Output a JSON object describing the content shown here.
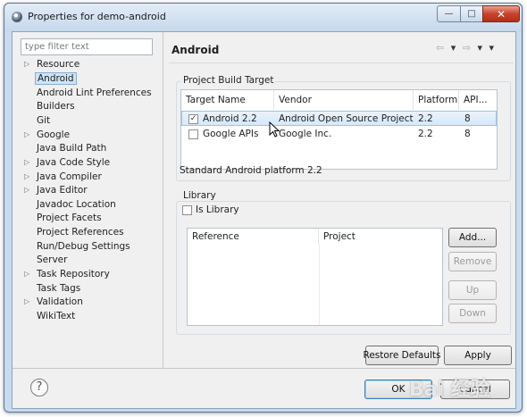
{
  "window": {
    "title": "Properties for demo-android",
    "controls": {
      "minimize": "—",
      "maximize": "□",
      "close": "✕"
    }
  },
  "sidebar": {
    "filter_placeholder": "type filter text",
    "items": [
      {
        "label": "Resource",
        "expandable": true
      },
      {
        "label": "Android",
        "expandable": false,
        "selected": true
      },
      {
        "label": "Android Lint Preferences",
        "expandable": false
      },
      {
        "label": "Builders",
        "expandable": false
      },
      {
        "label": "Git",
        "expandable": false
      },
      {
        "label": "Google",
        "expandable": true
      },
      {
        "label": "Java Build Path",
        "expandable": false
      },
      {
        "label": "Java Code Style",
        "expandable": true
      },
      {
        "label": "Java Compiler",
        "expandable": true
      },
      {
        "label": "Java Editor",
        "expandable": true
      },
      {
        "label": "Javadoc Location",
        "expandable": false
      },
      {
        "label": "Project Facets",
        "expandable": false
      },
      {
        "label": "Project References",
        "expandable": false
      },
      {
        "label": "Run/Debug Settings",
        "expandable": false
      },
      {
        "label": "Server",
        "expandable": false
      },
      {
        "label": "Task Repository",
        "expandable": true
      },
      {
        "label": "Task Tags",
        "expandable": false
      },
      {
        "label": "Validation",
        "expandable": true
      },
      {
        "label": "WikiText",
        "expandable": false
      }
    ]
  },
  "page": {
    "title": "Android",
    "nav": {
      "back": "⇦",
      "forward": "⇨",
      "dropdown": "▾",
      "menu": "▾"
    }
  },
  "build_target": {
    "group_label": "Project Build Target",
    "columns": [
      "Target Name",
      "Vendor",
      "Platform",
      "API..."
    ],
    "rows": [
      {
        "checked": true,
        "name": "Android 2.2",
        "vendor": "Android Open Source Project",
        "platform": "2.2",
        "api": "8"
      },
      {
        "checked": false,
        "name": "Google APIs",
        "vendor": "Google Inc.",
        "platform": "2.2",
        "api": "8"
      }
    ],
    "description": "Standard Android platform 2.2"
  },
  "library": {
    "group_label": "Library",
    "is_library_label": "Is Library",
    "columns": [
      "Reference",
      "Project"
    ],
    "buttons": {
      "add": "Add...",
      "remove": "Remove",
      "up": "Up",
      "down": "Down"
    }
  },
  "footer": {
    "restore_defaults": "Restore Defaults",
    "apply": "Apply",
    "ok": "OK",
    "cancel": "Cancel",
    "help": "?"
  },
  "watermark": "Bai 经验"
}
